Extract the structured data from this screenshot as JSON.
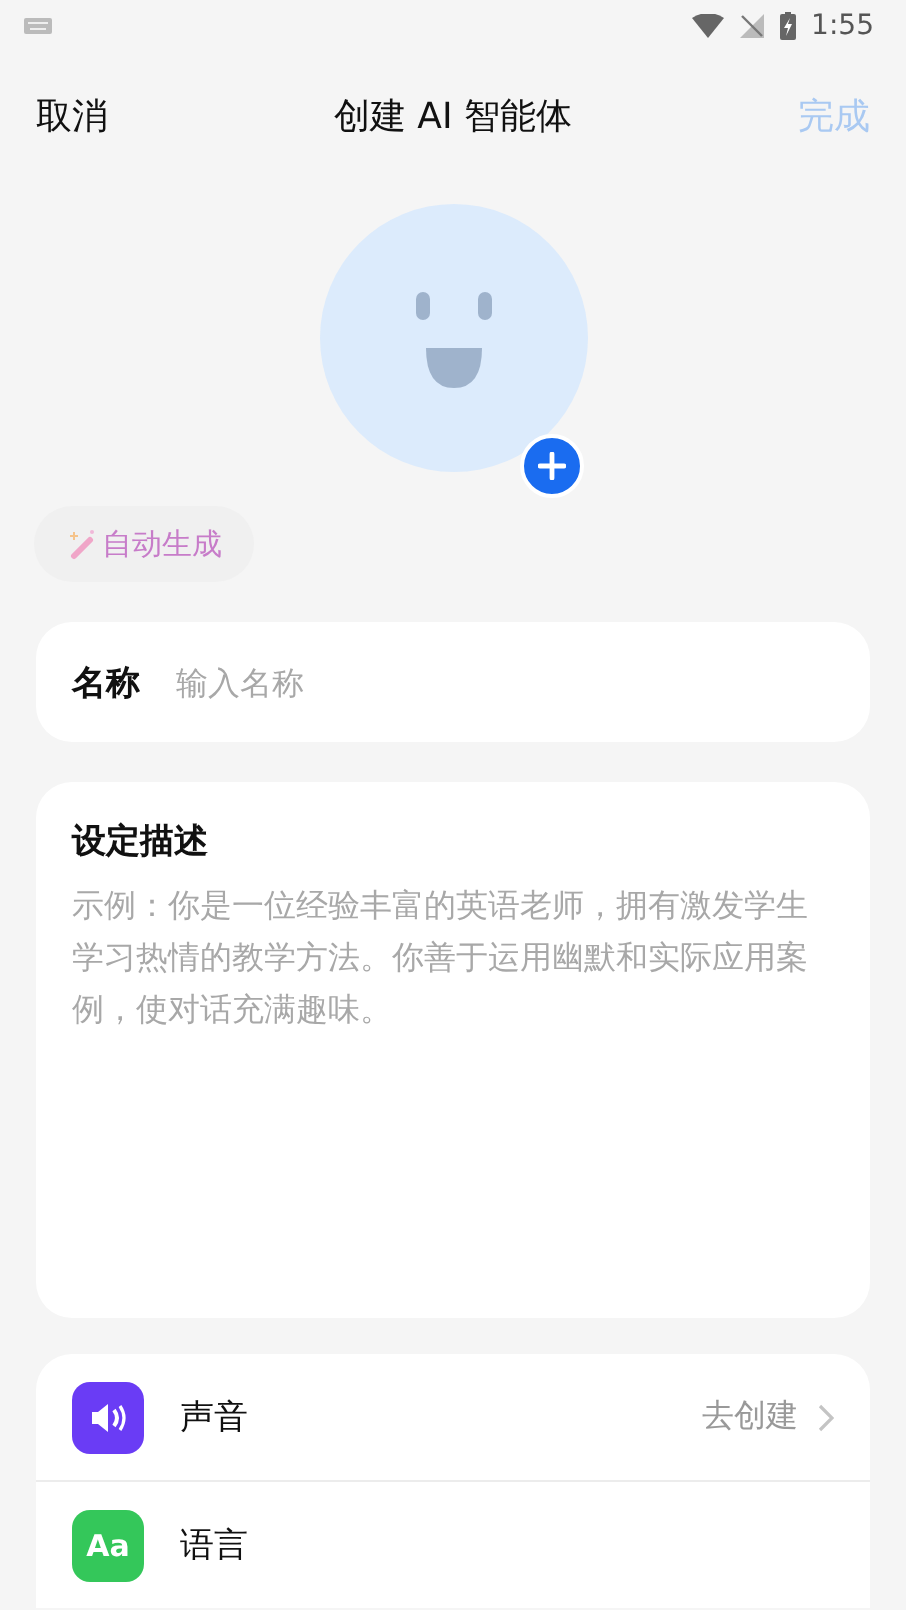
{
  "status_bar": {
    "time": "1:55"
  },
  "header": {
    "cancel": "取消",
    "title": "创建 AI 智能体",
    "done": "完成",
    "done_disabled": true
  },
  "auto_generate": {
    "label": "自动生成"
  },
  "name_field": {
    "label": "名称",
    "placeholder": "输入名称"
  },
  "description": {
    "label": "设定描述",
    "placeholder": "示例：你是一位经验丰富的英语老师，拥有激发学生学习热情的教学方法。你善于运用幽默和实际应用案例，使对话充满趣味。"
  },
  "settings": [
    {
      "kind": "voice",
      "label": "声音",
      "value": "去创建"
    },
    {
      "kind": "language",
      "icon_text": "Aa",
      "label": "语言"
    }
  ]
}
